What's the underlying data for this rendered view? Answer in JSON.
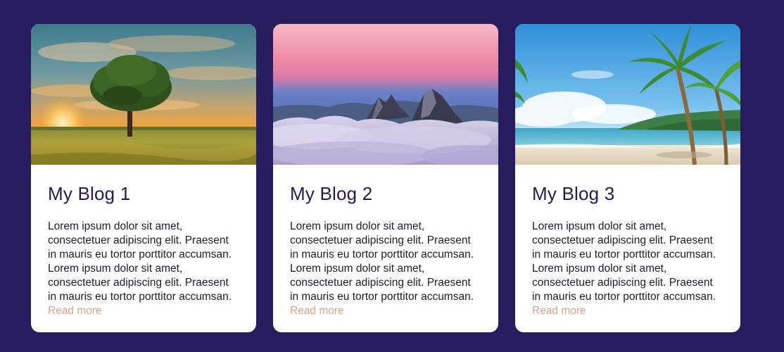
{
  "colors": {
    "background": "#271d5e",
    "card": "#ffffff",
    "title": "#231b56",
    "link": "#d7a389"
  },
  "cards": [
    {
      "image": "tree-field-sunset",
      "title": "My Blog 1",
      "text": "Lorem ipsum dolor sit amet, consectetuer adipiscing elit. Praesent in mauris eu tortor porttitor accumsan. Lorem ipsum dolor sit amet, consectetuer adipiscing elit. Praesent in mauris eu tortor porttitor accumsan.",
      "link": "Read more"
    },
    {
      "image": "mountain-peaks-clouds",
      "title": "My Blog 2",
      "text": "Lorem ipsum dolor sit amet, consectetuer adipiscing elit. Praesent in mauris eu tortor porttitor accumsan. Lorem ipsum dolor sit amet, consectetuer adipiscing elit. Praesent in mauris eu tortor porttitor accumsan.",
      "link": "Read more"
    },
    {
      "image": "tropical-beach-palms",
      "title": "My Blog 3",
      "text": "Lorem ipsum dolor sit amet, consectetuer adipiscing elit. Praesent in mauris eu tortor porttitor accumsan. Lorem ipsum dolor sit amet, consectetuer adipiscing elit. Praesent in mauris eu tortor porttitor accumsan.",
      "link": "Read more"
    }
  ]
}
